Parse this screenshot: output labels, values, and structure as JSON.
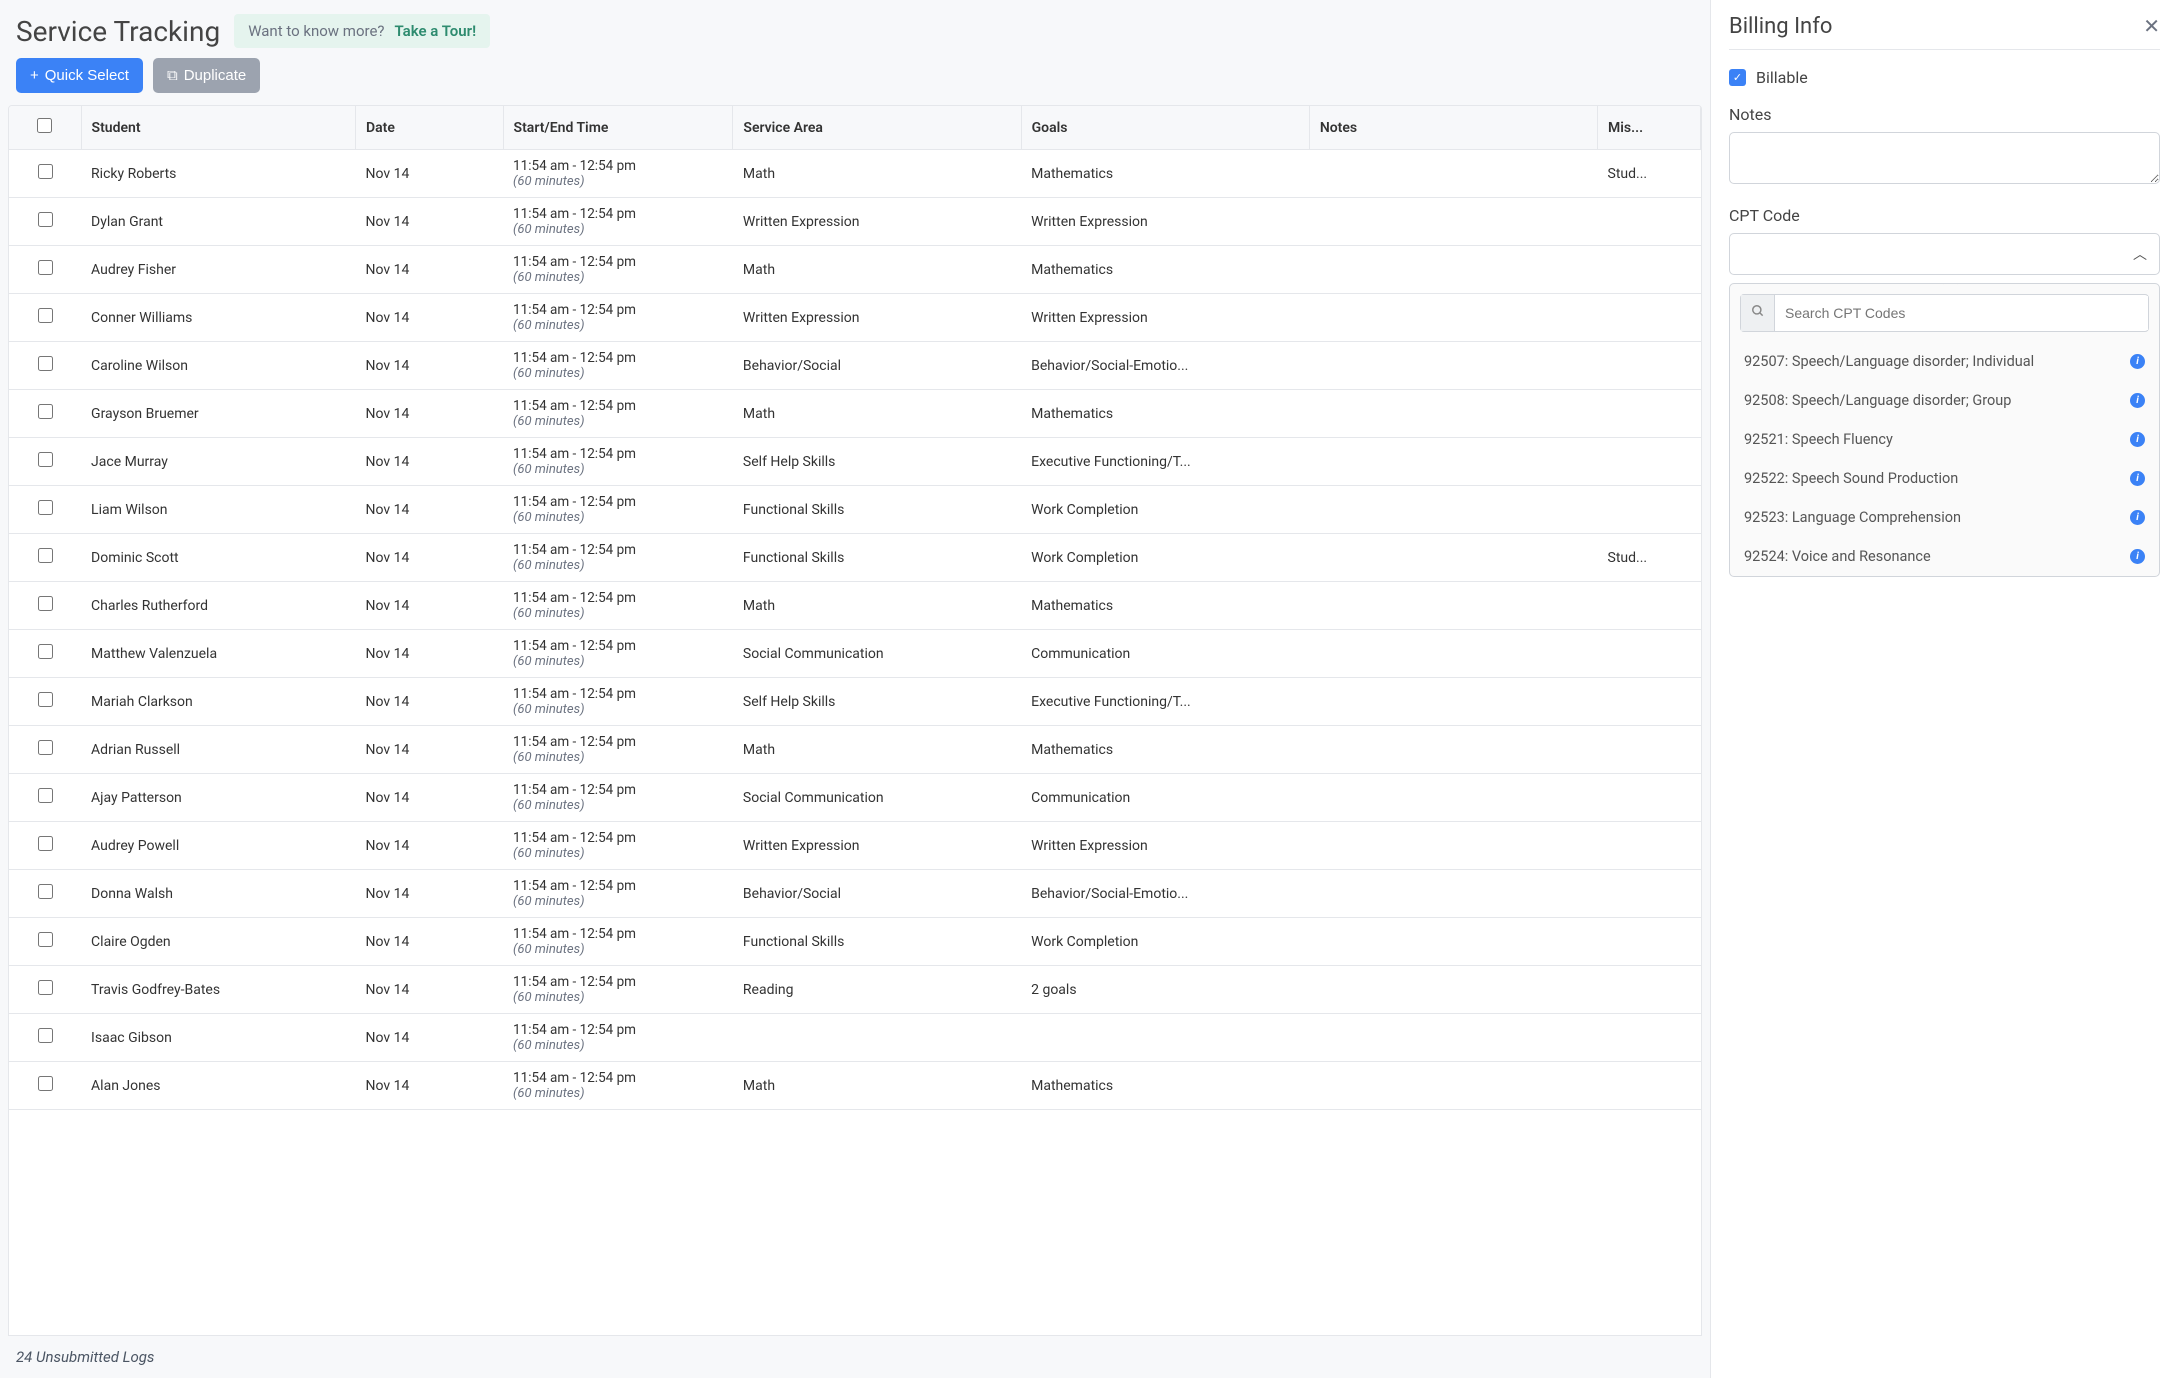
{
  "header": {
    "title": "Service Tracking",
    "tour_prompt": "Want to know more?",
    "tour_link": "Take a Tour!"
  },
  "toolbar": {
    "quick_select": "Quick Select",
    "duplicate": "Duplicate"
  },
  "columns": {
    "student": "Student",
    "date": "Date",
    "time": "Start/End Time",
    "service": "Service Area",
    "goals": "Goals",
    "notes": "Notes",
    "miss": "Mis..."
  },
  "rows": [
    {
      "student": "Ricky Roberts",
      "date": "Nov 14",
      "time": "11:54 am - 12:54 pm",
      "dur": "(60 minutes)",
      "service": "Math",
      "goals": "Mathematics",
      "notes": "",
      "miss": "Stud..."
    },
    {
      "student": "Dylan Grant",
      "date": "Nov 14",
      "time": "11:54 am - 12:54 pm",
      "dur": "(60 minutes)",
      "service": "Written Expression",
      "goals": "Written Expression",
      "notes": "",
      "miss": ""
    },
    {
      "student": "Audrey Fisher",
      "date": "Nov 14",
      "time": "11:54 am - 12:54 pm",
      "dur": "(60 minutes)",
      "service": "Math",
      "goals": "Mathematics",
      "notes": "",
      "miss": ""
    },
    {
      "student": "Conner Williams",
      "date": "Nov 14",
      "time": "11:54 am - 12:54 pm",
      "dur": "(60 minutes)",
      "service": "Written Expression",
      "goals": "Written Expression",
      "notes": "",
      "miss": ""
    },
    {
      "student": "Caroline Wilson",
      "date": "Nov 14",
      "time": "11:54 am - 12:54 pm",
      "dur": "(60 minutes)",
      "service": "Behavior/Social",
      "goals": "Behavior/Social-Emotio...",
      "notes": "",
      "miss": ""
    },
    {
      "student": "Grayson Bruemer",
      "date": "Nov 14",
      "time": "11:54 am - 12:54 pm",
      "dur": "(60 minutes)",
      "service": "Math",
      "goals": "Mathematics",
      "notes": "",
      "miss": ""
    },
    {
      "student": "Jace Murray",
      "date": "Nov 14",
      "time": "11:54 am - 12:54 pm",
      "dur": "(60 minutes)",
      "service": "Self Help Skills",
      "goals": "Executive Functioning/T...",
      "notes": "",
      "miss": ""
    },
    {
      "student": "Liam Wilson",
      "date": "Nov 14",
      "time": "11:54 am - 12:54 pm",
      "dur": "(60 minutes)",
      "service": "Functional Skills",
      "goals": "Work Completion",
      "notes": "",
      "miss": ""
    },
    {
      "student": "Dominic Scott",
      "date": "Nov 14",
      "time": "11:54 am - 12:54 pm",
      "dur": "(60 minutes)",
      "service": "Functional Skills",
      "goals": "Work Completion",
      "notes": "",
      "miss": "Stud..."
    },
    {
      "student": "Charles Rutherford",
      "date": "Nov 14",
      "time": "11:54 am - 12:54 pm",
      "dur": "(60 minutes)",
      "service": "Math",
      "goals": "Mathematics",
      "notes": "",
      "miss": ""
    },
    {
      "student": "Matthew Valenzuela",
      "date": "Nov 14",
      "time": "11:54 am - 12:54 pm",
      "dur": "(60 minutes)",
      "service": "Social Communication",
      "goals": "Communication",
      "notes": "",
      "miss": ""
    },
    {
      "student": "Mariah Clarkson",
      "date": "Nov 14",
      "time": "11:54 am - 12:54 pm",
      "dur": "(60 minutes)",
      "service": "Self Help Skills",
      "goals": "Executive Functioning/T...",
      "notes": "",
      "miss": ""
    },
    {
      "student": "Adrian Russell",
      "date": "Nov 14",
      "time": "11:54 am - 12:54 pm",
      "dur": "(60 minutes)",
      "service": "Math",
      "goals": "Mathematics",
      "notes": "",
      "miss": ""
    },
    {
      "student": "Ajay Patterson",
      "date": "Nov 14",
      "time": "11:54 am - 12:54 pm",
      "dur": "(60 minutes)",
      "service": "Social Communication",
      "goals": "Communication",
      "notes": "",
      "miss": ""
    },
    {
      "student": "Audrey Powell",
      "date": "Nov 14",
      "time": "11:54 am - 12:54 pm",
      "dur": "(60 minutes)",
      "service": "Written Expression",
      "goals": "Written Expression",
      "notes": "",
      "miss": ""
    },
    {
      "student": "Donna Walsh",
      "date": "Nov 14",
      "time": "11:54 am - 12:54 pm",
      "dur": "(60 minutes)",
      "service": "Behavior/Social",
      "goals": "Behavior/Social-Emotio...",
      "notes": "",
      "miss": ""
    },
    {
      "student": "Claire Ogden",
      "date": "Nov 14",
      "time": "11:54 am - 12:54 pm",
      "dur": "(60 minutes)",
      "service": "Functional Skills",
      "goals": "Work Completion",
      "notes": "",
      "miss": ""
    },
    {
      "student": "Travis Godfrey-Bates",
      "date": "Nov 14",
      "time": "11:54 am - 12:54 pm",
      "dur": "(60 minutes)",
      "service": "Reading",
      "goals": "2 goals",
      "notes": "",
      "miss": ""
    },
    {
      "student": "Isaac Gibson",
      "date": "Nov 14",
      "time": "11:54 am - 12:54 pm",
      "dur": "(60 minutes)",
      "service": "",
      "goals": "",
      "notes": "",
      "miss": ""
    },
    {
      "student": "Alan Jones",
      "date": "Nov 14",
      "time": "11:54 am - 12:54 pm",
      "dur": "(60 minutes)",
      "service": "Math",
      "goals": "Mathematics",
      "notes": "",
      "miss": ""
    }
  ],
  "footer": {
    "unsubmitted": "24 Unsubmitted Logs"
  },
  "sidepanel": {
    "title": "Billing Info",
    "billable_label": "Billable",
    "notes_label": "Notes",
    "cpt_label": "CPT Code",
    "search_placeholder": "Search CPT Codes",
    "cpt_options": [
      "92507: Speech/Language disorder; Individual",
      "92508: Speech/Language disorder; Group",
      "92521: Speech Fluency",
      "92522: Speech Sound Production",
      "92523: Language Comprehension",
      "92524: Voice and Resonance"
    ]
  }
}
